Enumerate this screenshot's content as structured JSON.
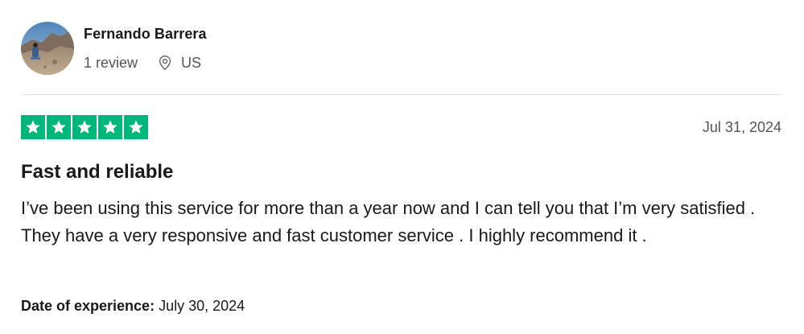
{
  "consumer": {
    "name": "Fernando Barrera",
    "review_count": "1 review",
    "location": "US",
    "avatar_icon": "avatar-photo",
    "location_icon": "location-pin-icon"
  },
  "review": {
    "rating": 5,
    "rating_max": 5,
    "star_color": "#00b67a",
    "date": "Jul 31, 2024",
    "title": "Fast and reliable",
    "text": "I’ve been using this service for more than a year now and I can tell you that I’m very satisfied . They have a very responsive and fast customer service . I highly recommend it .",
    "experience_label": "Date of experience:",
    "experience_date": "July 30, 2024"
  }
}
